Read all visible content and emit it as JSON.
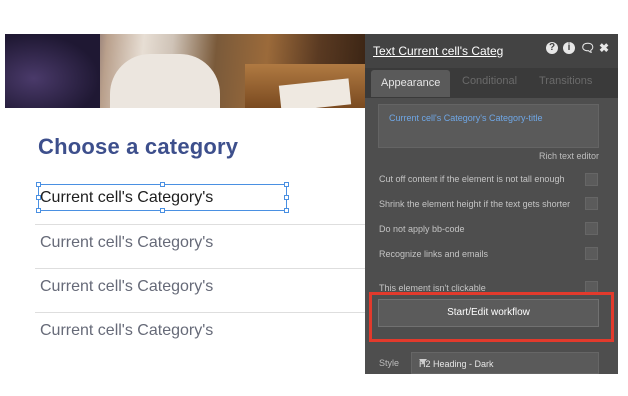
{
  "canvas": {
    "heading": "Choose a category",
    "rows": [
      "Current cell's Category's",
      "Current cell's Category's",
      "Current cell's Category's",
      "Current cell's Category's"
    ]
  },
  "panel": {
    "title": "Text Current cell's Categ",
    "header_icons": [
      "help-icon",
      "info-icon",
      "comment-icon",
      "close-icon"
    ],
    "tabs": [
      {
        "label": "Appearance",
        "active": true
      },
      {
        "label": "Conditional",
        "active": false
      },
      {
        "label": "Transitions",
        "active": false
      }
    ],
    "text_value": "Current cell's Category's Category-title",
    "rich_text_label": "Rich text editor",
    "options": [
      "Cut off content if the element is not tall enough",
      "Shrink the element height if the text gets shorter",
      "Do not apply bb-code",
      "Recognize links and emails",
      "This element isn't clickable"
    ],
    "workflow_button": "Start/Edit workflow",
    "style_label": "Style",
    "style_value": "H2 Heading - Dark"
  },
  "colors": {
    "heading": "#3d4f8c",
    "selection": "#4a90e2",
    "panel_bg": "#4e4e4e",
    "highlight_frame": "#e23a2c",
    "text_value": "#6fa7e6"
  }
}
